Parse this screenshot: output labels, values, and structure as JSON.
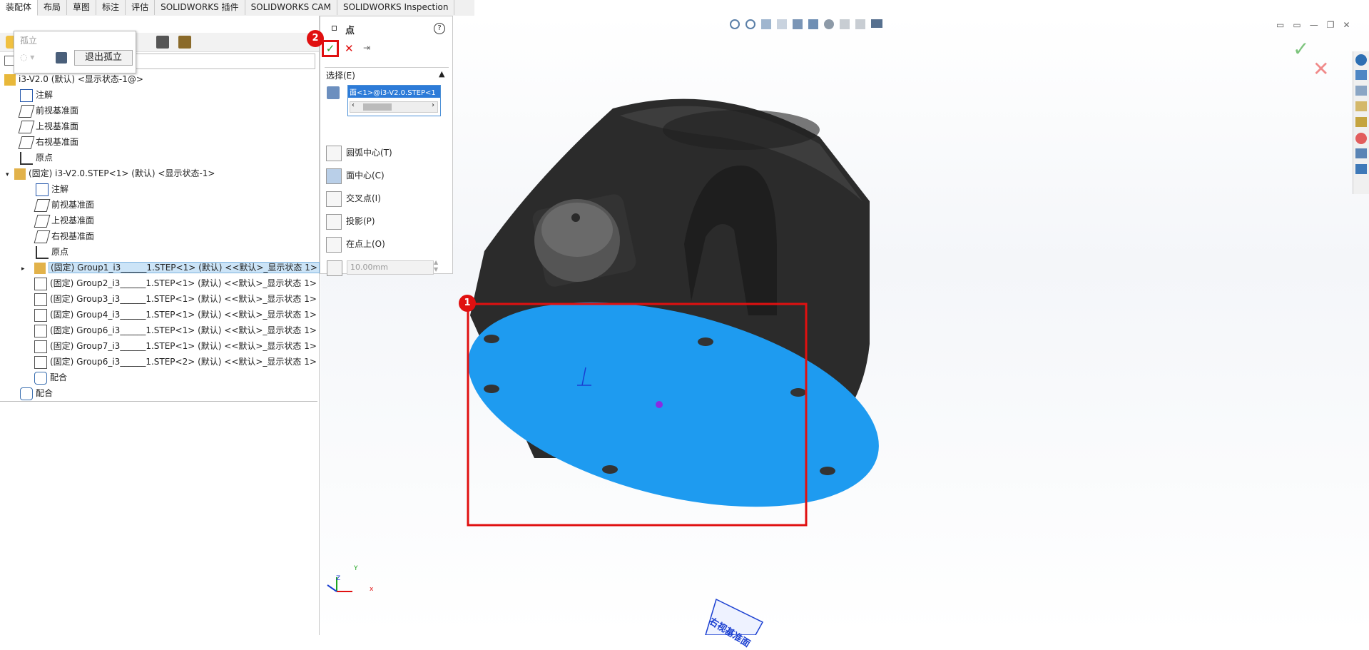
{
  "tabs": [
    "装配体",
    "布局",
    "草图",
    "标注",
    "评估",
    "SOLIDWORKS 插件",
    "SOLIDWORKS CAM",
    "SOLIDWORKS Inspection"
  ],
  "isolate_popup": {
    "title": "孤立",
    "exit_label": "退出孤立"
  },
  "tree": {
    "root": "i3-V2.0 (默认) <显示状态-1@>",
    "root_children": [
      "注解",
      "前视基准面",
      "上视基准面",
      "右视基准面",
      "原点"
    ],
    "part": "(固定) i3-V2.0.STEP<1> (默认) <显示状态-1>",
    "part_children": [
      "注解",
      "前视基准面",
      "上视基准面",
      "右视基准面",
      "原点"
    ],
    "groups": [
      "(固定) Group1_i3______1.STEP<1> (默认) <<默认>_显示状态 1>",
      "(固定) Group2_i3______1.STEP<1> (默认) <<默认>_显示状态 1>",
      "(固定) Group3_i3______1.STEP<1> (默认) <<默认>_显示状态 1>",
      "(固定) Group4_i3______1.STEP<1> (默认) <<默认>_显示状态 1>",
      "(固定) Group6_i3______1.STEP<1> (默认) <<默认>_显示状态 1>",
      "(固定) Group7_i3______1.STEP<1> (默认) <<默认>_显示状态 1>",
      "(固定) Group6_i3______1.STEP<2> (默认) <<默认>_显示状态 1>"
    ],
    "mates_inner": "配合",
    "mates_outer": "配合"
  },
  "propmgr": {
    "title": "点",
    "section": "选择(E)",
    "selection_value": "面<1>@i3-V2.0.STEP<1",
    "options": [
      "圆弧中心(T)",
      "面中心(C)",
      "交叉点(I)",
      "投影(P)",
      "在点上(O)"
    ],
    "distance": "10.00mm"
  },
  "annotations": {
    "one": "1",
    "two": "2"
  },
  "plane_label": "右视基准面",
  "axis": {
    "x": "x",
    "y": "Y",
    "z": "Z"
  },
  "colors": {
    "face": "#1e9bf0",
    "body": "#2b2b2b",
    "highlight": "#e01010",
    "accept": "#2a9d2a"
  }
}
